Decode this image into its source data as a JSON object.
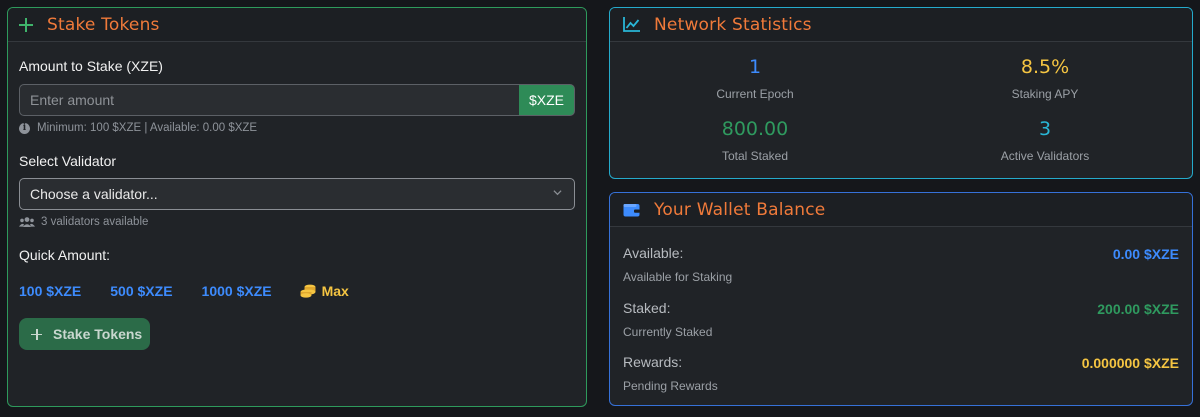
{
  "stake": {
    "title": "Stake Tokens",
    "amount_label": "Amount to Stake (XZE)",
    "amount_placeholder": "Enter amount",
    "amount_value": "",
    "unit": "$XZE",
    "amount_hint": "Minimum: 100 $XZE | Available: 0.00 $XZE",
    "validator_label": "Select Validator",
    "validator_selected": "Choose a validator...",
    "validator_hint": "3 validators available",
    "quick_label": "Quick Amount:",
    "quick_amounts": [
      "100 $XZE",
      "500 $XZE",
      "1000 $XZE"
    ],
    "max_label": "Max",
    "submit_label": "Stake Tokens"
  },
  "network": {
    "title": "Network Statistics",
    "stats": [
      {
        "value": "1",
        "label": "Current Epoch",
        "color": "#3d8bfd"
      },
      {
        "value": "8.5%",
        "label": "Staking APY",
        "color": "#f5c542"
      },
      {
        "value": "800.00",
        "label": "Total Staked",
        "color": "#2f9a5f"
      },
      {
        "value": "3",
        "label": "Active Validators",
        "color": "#29b6d6"
      }
    ]
  },
  "wallet": {
    "title": "Your Wallet Balance",
    "rows": [
      {
        "name": "Available:",
        "sub": "Available for Staking",
        "value": "0.00 $XZE",
        "color": "#3d8bfd"
      },
      {
        "name": "Staked:",
        "sub": "Currently Staked",
        "value": "200.00 $XZE",
        "color": "#2f9a5f"
      },
      {
        "name": "Rewards:",
        "sub": "Pending Rewards",
        "value": "0.000000 $XZE",
        "color": "#f5c542"
      }
    ]
  },
  "colors": {
    "accent_title": "#f07a3a",
    "success": "#2e8b57",
    "info": "#25aacb",
    "primary": "#3671d8"
  },
  "icons": [
    "plus-icon",
    "info-icon",
    "users-icon",
    "chevron-down-icon",
    "coins-icon",
    "chart-line-icon",
    "wallet-icon"
  ]
}
